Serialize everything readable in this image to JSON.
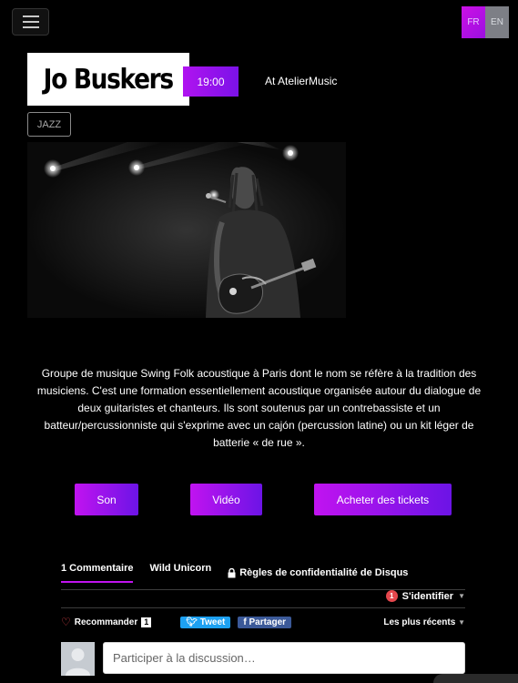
{
  "header": {
    "menu_icon": "hamburger-icon",
    "lang": {
      "fr": "FR",
      "en": "EN",
      "active": "FR"
    }
  },
  "event": {
    "title": "Jo Buskers",
    "time": "19:00",
    "venue": "At AtelierMusic",
    "tag": "JAZZ",
    "description": "Groupe de musique Swing Folk acoustique à Paris dont le nom se réfère à la tradition des musiciens. C'est une formation essentiellement acoustique organisée autour du dialogue de deux guitaristes et chanteurs. Ils sont soutenus par un contrebassiste et un batteur/percussionniste qui s'exprime avec un cajón (percussion latine) ou un kit léger de batterie « de rue »."
  },
  "actions": {
    "son": "Son",
    "video": "Vidéo",
    "tickets": "Acheter des tickets"
  },
  "disqus": {
    "tab_comments": "1 Commentaire",
    "tab_site": "Wild Unicorn",
    "tab_privacy": "Règles de confidentialité de Disqus",
    "notification_count": "1",
    "login": "S'identifier",
    "recommend": "Recommander",
    "recommend_count": "1",
    "tweet": "Tweet",
    "share": "Partager",
    "sort": "Les plus récents",
    "placeholder": "Participer à la discussion…"
  },
  "colors": {
    "accent_start": "#c113f0",
    "accent_end": "#6c14e6",
    "background": "#000000"
  }
}
